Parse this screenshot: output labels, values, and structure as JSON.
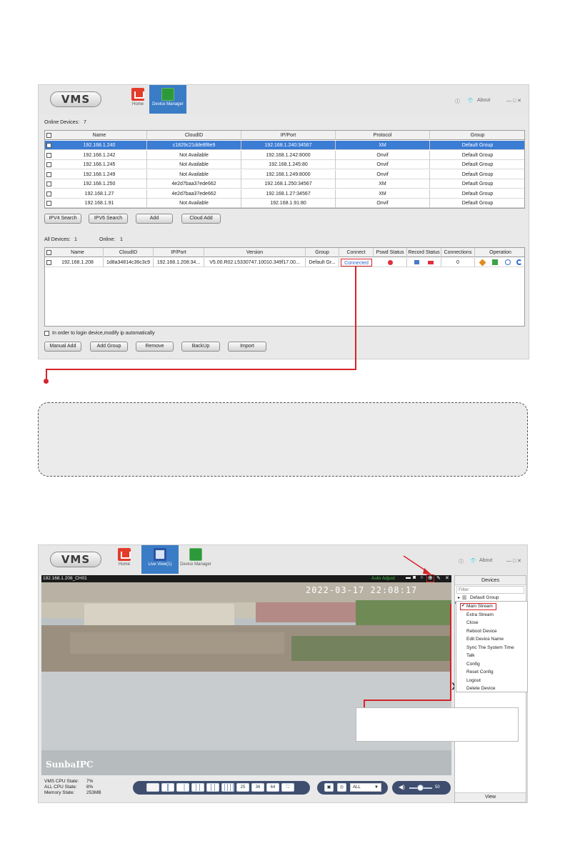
{
  "top_window": {
    "logo": "VMS",
    "nav": [
      {
        "label": "Home"
      },
      {
        "label": "Device Manager"
      }
    ],
    "about": "About",
    "win_controls": "— □ ✕",
    "online_devices_label": "Online Devices:",
    "online_devices_count": "7",
    "online_columns": [
      "Name",
      "CloudID",
      "IP/Port",
      "Protocol",
      "Group"
    ],
    "online_rows": [
      [
        "192.168.1.240",
        "c1829c21dde8f8e9",
        "192.168.1.240:34567",
        "XM",
        "Default Group"
      ],
      [
        "192.168.1.242",
        "Not Available",
        "192.168.1.242:8000",
        "Onvif",
        "Default Group"
      ],
      [
        "192.168.1.245",
        "Not Available",
        "192.168.1.245:80",
        "Onvif",
        "Default Group"
      ],
      [
        "192.168.1.249",
        "Not Available",
        "192.168.1.249:8000",
        "Onvif",
        "Default Group"
      ],
      [
        "192.168.1.250",
        "4e2d7baa37ede662",
        "192.168.1.250:34567",
        "XM",
        "Default Group"
      ],
      [
        "192.168.1.27",
        "4e2d7baa37ede662",
        "192.168.1.27:34567",
        "XM",
        "Default Group"
      ],
      [
        "192.168.1.91",
        "Not Available",
        "192.168.1.91:80",
        "Onvif",
        "Default Group"
      ]
    ],
    "search_buttons": [
      "IPV4 Search",
      "IPV6 Search",
      "Add",
      "Cloud Add"
    ],
    "all_devices_label": "All Devices:",
    "all_devices_count": "1",
    "online_label": "Online:",
    "online_count": "1",
    "all_columns": [
      "Name",
      "CloudID",
      "IP/Port",
      "Version",
      "Group",
      "Connect",
      "Pswd Status",
      "Record Status",
      "Connections",
      "Operation"
    ],
    "all_rows": [
      [
        "192.168.1.208",
        "1d8a34814c36c3c9",
        "192.168.1.208:34...",
        "V5.00.R02.L5330747.10010.349f17.00...",
        "Default Gr...",
        "Connected",
        "",
        "",
        "0",
        ""
      ]
    ],
    "auto_ip_label": "In order to login device,modify ip automatically",
    "bottom_buttons": [
      "Manual Add",
      "Add Group",
      "Remove",
      "BackUp",
      "Import"
    ]
  },
  "bottom_window": {
    "logo": "VMS",
    "nav": [
      {
        "label": "Home"
      },
      {
        "label": "Live View(1)"
      },
      {
        "label": "Device Manager"
      }
    ],
    "about": "About",
    "win_controls": "— □ ✕",
    "channel_title": "192.168.1.208_CH01",
    "auto_adjust": "Auto Adjust",
    "osd_time": "2022-03-17 22:08:17",
    "osd_name": "SunbaIPC",
    "devices_header": "Devices",
    "filter_placeholder": "Filter",
    "tree_group": "Default Group",
    "context_menu": [
      "Main Stream",
      "Extra Stream",
      "Close",
      "Reboot Device",
      "Edit Device Name",
      "Sync The System Time",
      "Talk",
      "Config",
      "Reset Config",
      "Logout",
      "Delete Device"
    ],
    "view_button": "View",
    "status": [
      {
        "label": "VMS CPU State:",
        "value": "7%"
      },
      {
        "label": "ALL CPU State:",
        "value": "8%"
      },
      {
        "label": "Memory State:",
        "value": "253MB"
      }
    ],
    "layout_buttons": [
      "25",
      "36",
      "64"
    ],
    "stream_select": "ALL",
    "volume": "50"
  }
}
